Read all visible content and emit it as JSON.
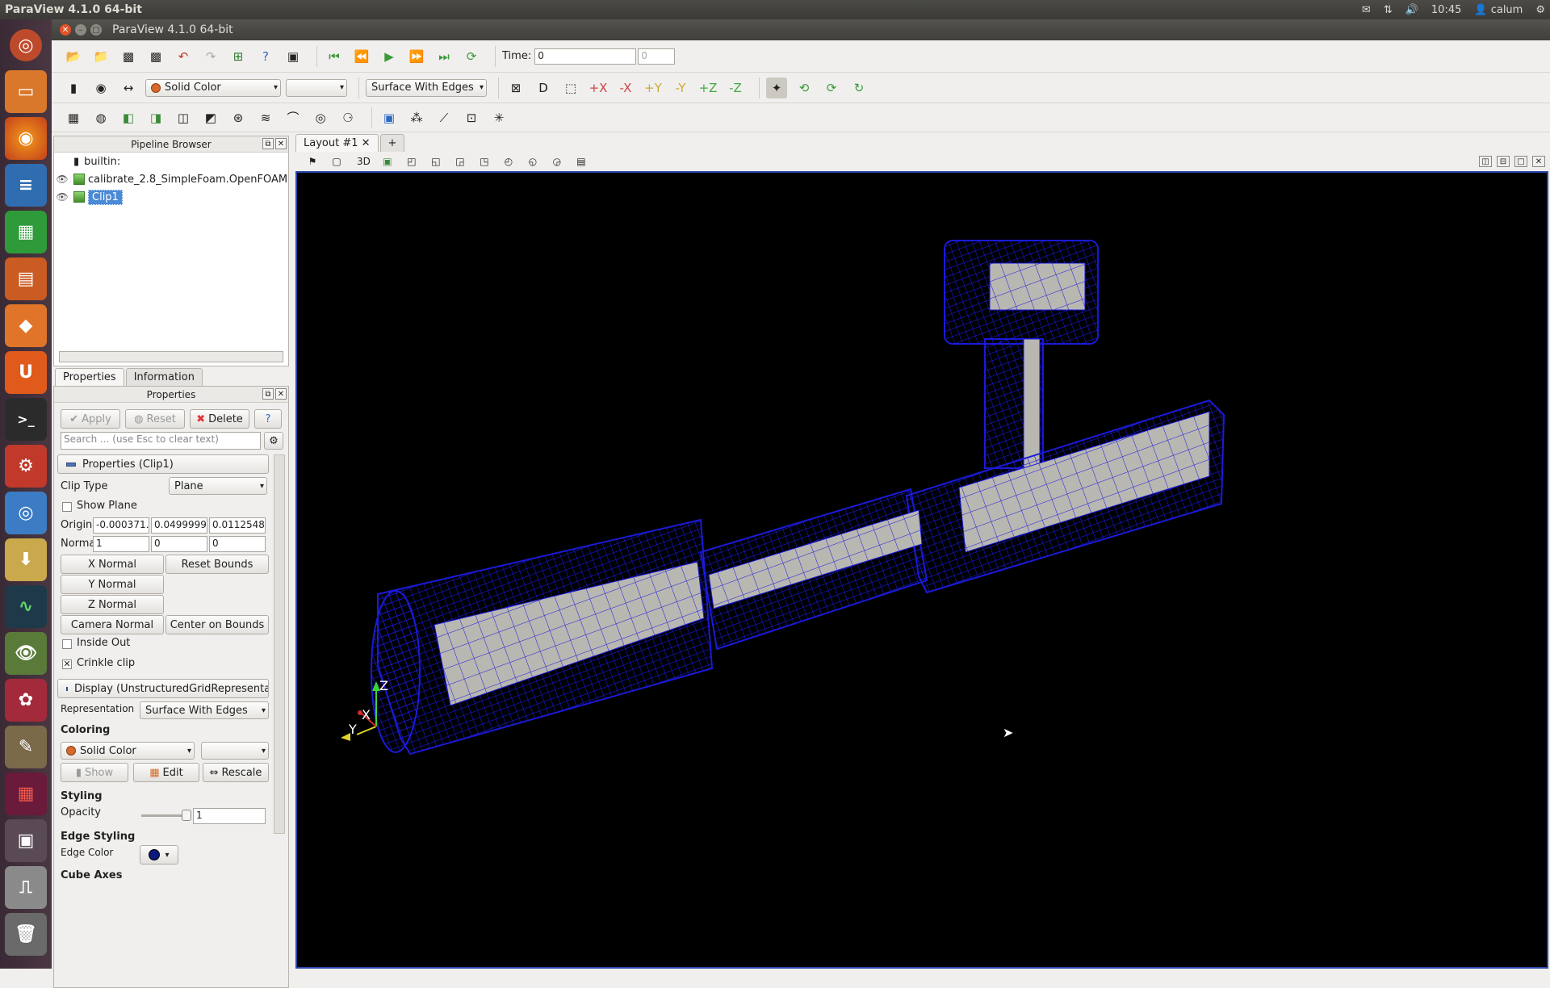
{
  "topbar": {
    "title": "ParaView 4.1.0 64-bit",
    "time": "10:45",
    "user": "calum"
  },
  "window": {
    "title": "ParaView 4.1.0 64-bit"
  },
  "toolbar1": {
    "time_label": "Time:",
    "time_value": "0",
    "time_step": "0"
  },
  "toolbar2": {
    "color_by": "Solid Color",
    "representation": "Surface With Edges"
  },
  "pipeline": {
    "title": "Pipeline Browser",
    "items": [
      "builtin:",
      "calibrate_2.8_SimpleFoam.OpenFOAM",
      "Clip1"
    ]
  },
  "tabs": {
    "properties": "Properties",
    "information": "Information"
  },
  "props": {
    "title": "Properties",
    "apply": "Apply",
    "reset": "Reset",
    "delete": "Delete",
    "help": "?",
    "search_placeholder": "Search ... (use Esc to clear text)",
    "group_properties": "Properties (Clip1)",
    "clip_type_label": "Clip Type",
    "clip_type": "Plane",
    "show_plane": "Show Plane",
    "origin_label": "Origin",
    "origin": [
      "-0.000371…",
      "0.0499999",
      "0.0112548"
    ],
    "normal_label": "Normal",
    "normal": [
      "1",
      "0",
      "0"
    ],
    "x_normal": "X Normal",
    "y_normal": "Y Normal",
    "z_normal": "Z Normal",
    "reset_bounds": "Reset Bounds",
    "camera_normal": "Camera Normal",
    "center_on_bounds": "Center on Bounds",
    "inside_out": "Inside Out",
    "crinkle_clip": "Crinkle clip",
    "group_display": "Display (UnstructuredGridRepresentation)",
    "representation_label": "Representation",
    "representation": "Surface With Edges",
    "coloring": "Coloring",
    "coloring_value": "Solid Color",
    "show": "Show",
    "edit": "Edit",
    "rescale": "Rescale",
    "styling": "Styling",
    "opacity_label": "Opacity",
    "opacity": "1",
    "edge_styling": "Edge Styling",
    "edge_color_label": "Edge Color",
    "cube_axes": "Cube Axes"
  },
  "layout": {
    "tab": "Layout #1",
    "add": "+",
    "mode": "3D"
  },
  "axes": {
    "z": "Z",
    "x": "X",
    "y": "Y"
  },
  "colors": {
    "mesh_edge": "#1a1ad8",
    "surface": "#b9b7b2",
    "background": "#000000",
    "accent": "#4a8ad6"
  }
}
